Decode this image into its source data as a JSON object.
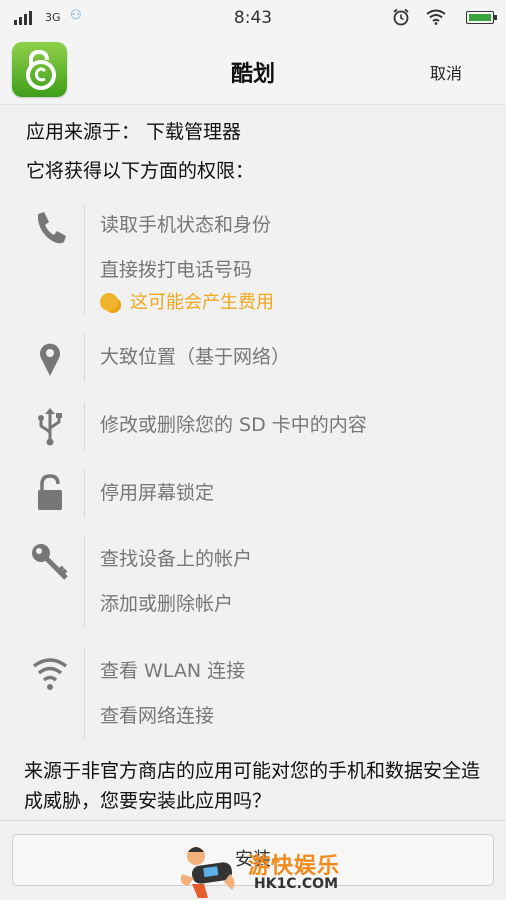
{
  "status_bar": {
    "network": "3G",
    "time": "8:43"
  },
  "header": {
    "app_name": "酷划",
    "cancel_label": "取消"
  },
  "source_line": "应用来源于： 下载管理器",
  "intro_line": "它将获得以下方面的权限：",
  "permissions": [
    {
      "icon": "phone-icon",
      "items": [
        "读取手机状态和身份",
        "直接拨打电话号码"
      ],
      "cost_note": "这可能会产生费用"
    },
    {
      "icon": "location-pin-icon",
      "items": [
        "大致位置（基于网络）"
      ]
    },
    {
      "icon": "usb-icon",
      "items": [
        "修改或删除您的 SD 卡中的内容"
      ]
    },
    {
      "icon": "lock-icon",
      "items": [
        "停用屏幕锁定"
      ]
    },
    {
      "icon": "key-icon",
      "items": [
        "查找设备上的帐户",
        "添加或删除帐户"
      ]
    },
    {
      "icon": "wifi-icon",
      "items": [
        "查看 WLAN 连接",
        "查看网络连接"
      ]
    }
  ],
  "warning": "来源于非官方商店的应用可能对您的手机和数据安全造成威胁，您要安装此应用吗？",
  "install_label": "安装",
  "watermark": {
    "cn": "游快娱乐",
    "en": "HK1C.COM"
  },
  "colors": {
    "accent_green": "#3f9e1a",
    "cost_orange": "#f0a81c",
    "watermark_orange": "#f28a1c"
  }
}
